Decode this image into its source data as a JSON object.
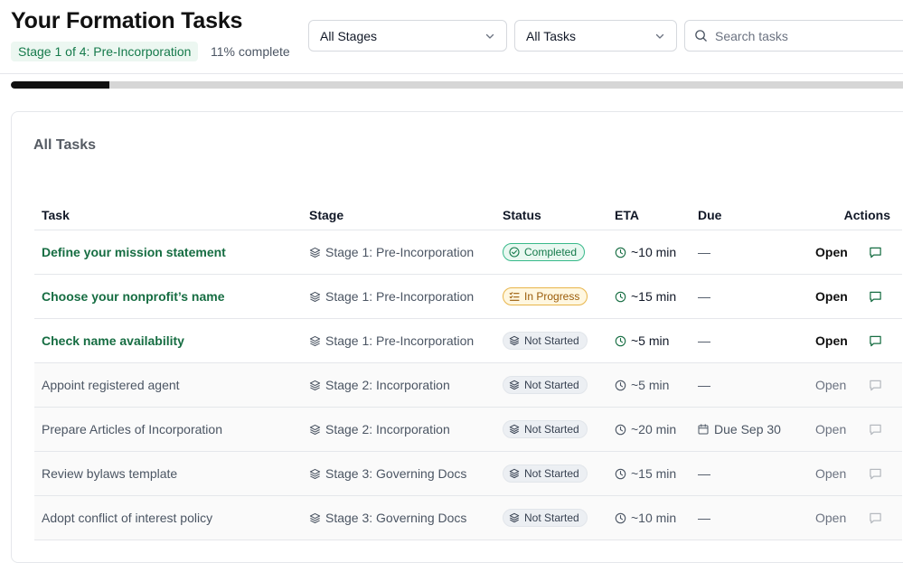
{
  "header": {
    "title": "Your Formation Tasks",
    "stage_badge": "Stage 1 of 4: Pre-Incorporation",
    "progress_text": "11% complete",
    "progress_fraction": 0.11,
    "stage_filter": "All Stages",
    "task_filter": "All Tasks",
    "search_placeholder": "Search tasks"
  },
  "card": {
    "title": "All Tasks",
    "columns": {
      "task": "Task",
      "stage": "Stage",
      "status": "Status",
      "eta": "ETA",
      "due": "Due",
      "actions": "Actions"
    },
    "rows": [
      {
        "task": "Define your mission statement",
        "stage": "Stage 1: Pre-Incorporation",
        "status": "Completed",
        "status_type": "completed",
        "eta": "~10 min",
        "due": "—",
        "open": "Open",
        "active": true
      },
      {
        "task": "Choose your nonprofit’s name",
        "stage": "Stage 1: Pre-Incorporation",
        "status": "In Progress",
        "status_type": "progress",
        "eta": "~15 min",
        "due": "—",
        "open": "Open",
        "active": true
      },
      {
        "task": "Check name availability",
        "stage": "Stage 1: Pre-Incorporation",
        "status": "Not Started",
        "status_type": "notstarted",
        "eta": "~5 min",
        "due": "—",
        "open": "Open",
        "active": true
      },
      {
        "task": "Appoint registered agent",
        "stage": "Stage 2: Incorporation",
        "status": "Not Started",
        "status_type": "notstarted",
        "eta": "~5 min",
        "due": "—",
        "open": "Open",
        "active": false
      },
      {
        "task": "Prepare Articles of Incorporation",
        "stage": "Stage 2: Incorporation",
        "status": "Not Started",
        "status_type": "notstarted",
        "eta": "~20 min",
        "due": "Due Sep 30",
        "due_icon": true,
        "open": "Open",
        "active": false
      },
      {
        "task": "Review bylaws template",
        "stage": "Stage 3: Governing Docs",
        "status": "Not Started",
        "status_type": "notstarted",
        "eta": "~15 min",
        "due": "—",
        "open": "Open",
        "active": false
      },
      {
        "task": "Adopt conflict of interest policy",
        "stage": "Stage 3: Governing Docs",
        "status": "Not Started",
        "status_type": "notstarted",
        "eta": "~10 min",
        "due": "—",
        "open": "Open",
        "active": false
      }
    ]
  },
  "colors": {
    "accent_green": "#166d42",
    "badge_green_bg": "#ecf7f1",
    "progress_fill": "#111111",
    "progress_track": "#d6d6d6"
  }
}
